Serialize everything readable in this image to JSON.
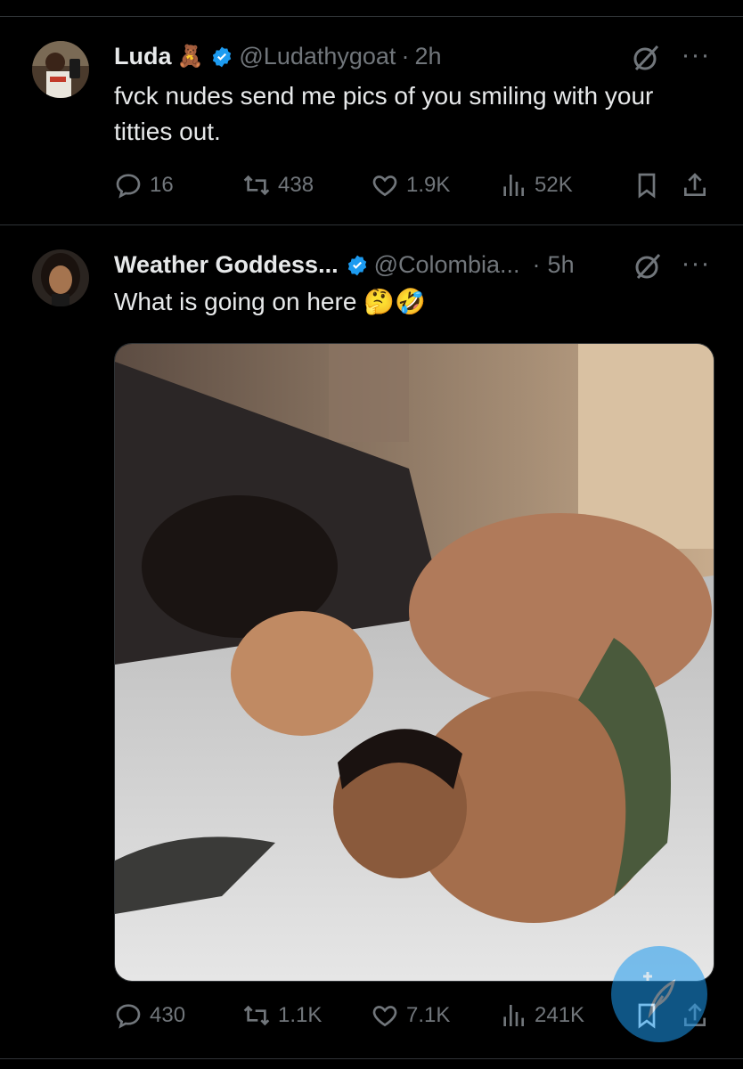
{
  "tweets": [
    {
      "name": "Luda",
      "name_emoji": "🧸",
      "handle": "@Ludathygoat",
      "separator": "·",
      "time": "2h",
      "text": "fvck nudes send me pics of you smiling with your titties out.",
      "replies": "16",
      "reposts": "438",
      "likes": "1.9K",
      "views": "52K"
    },
    {
      "name": "Weather Goddess...",
      "handle": "@Colombia...",
      "separator": "·",
      "time": "5h",
      "text": "What is going on here 🤔🤣",
      "replies": "430",
      "reposts": "1.1K",
      "likes": "7.1K",
      "views": "241K"
    }
  ],
  "colors": {
    "accent": "#1d9bf0",
    "muted": "#71767b",
    "text": "#e7e9ea",
    "background": "#000000"
  },
  "icons": [
    "verified-badge-icon",
    "grok-icon",
    "more-icon",
    "reply-icon",
    "repost-icon",
    "like-icon",
    "views-icon",
    "bookmark-icon",
    "share-icon",
    "compose-feather-icon"
  ]
}
